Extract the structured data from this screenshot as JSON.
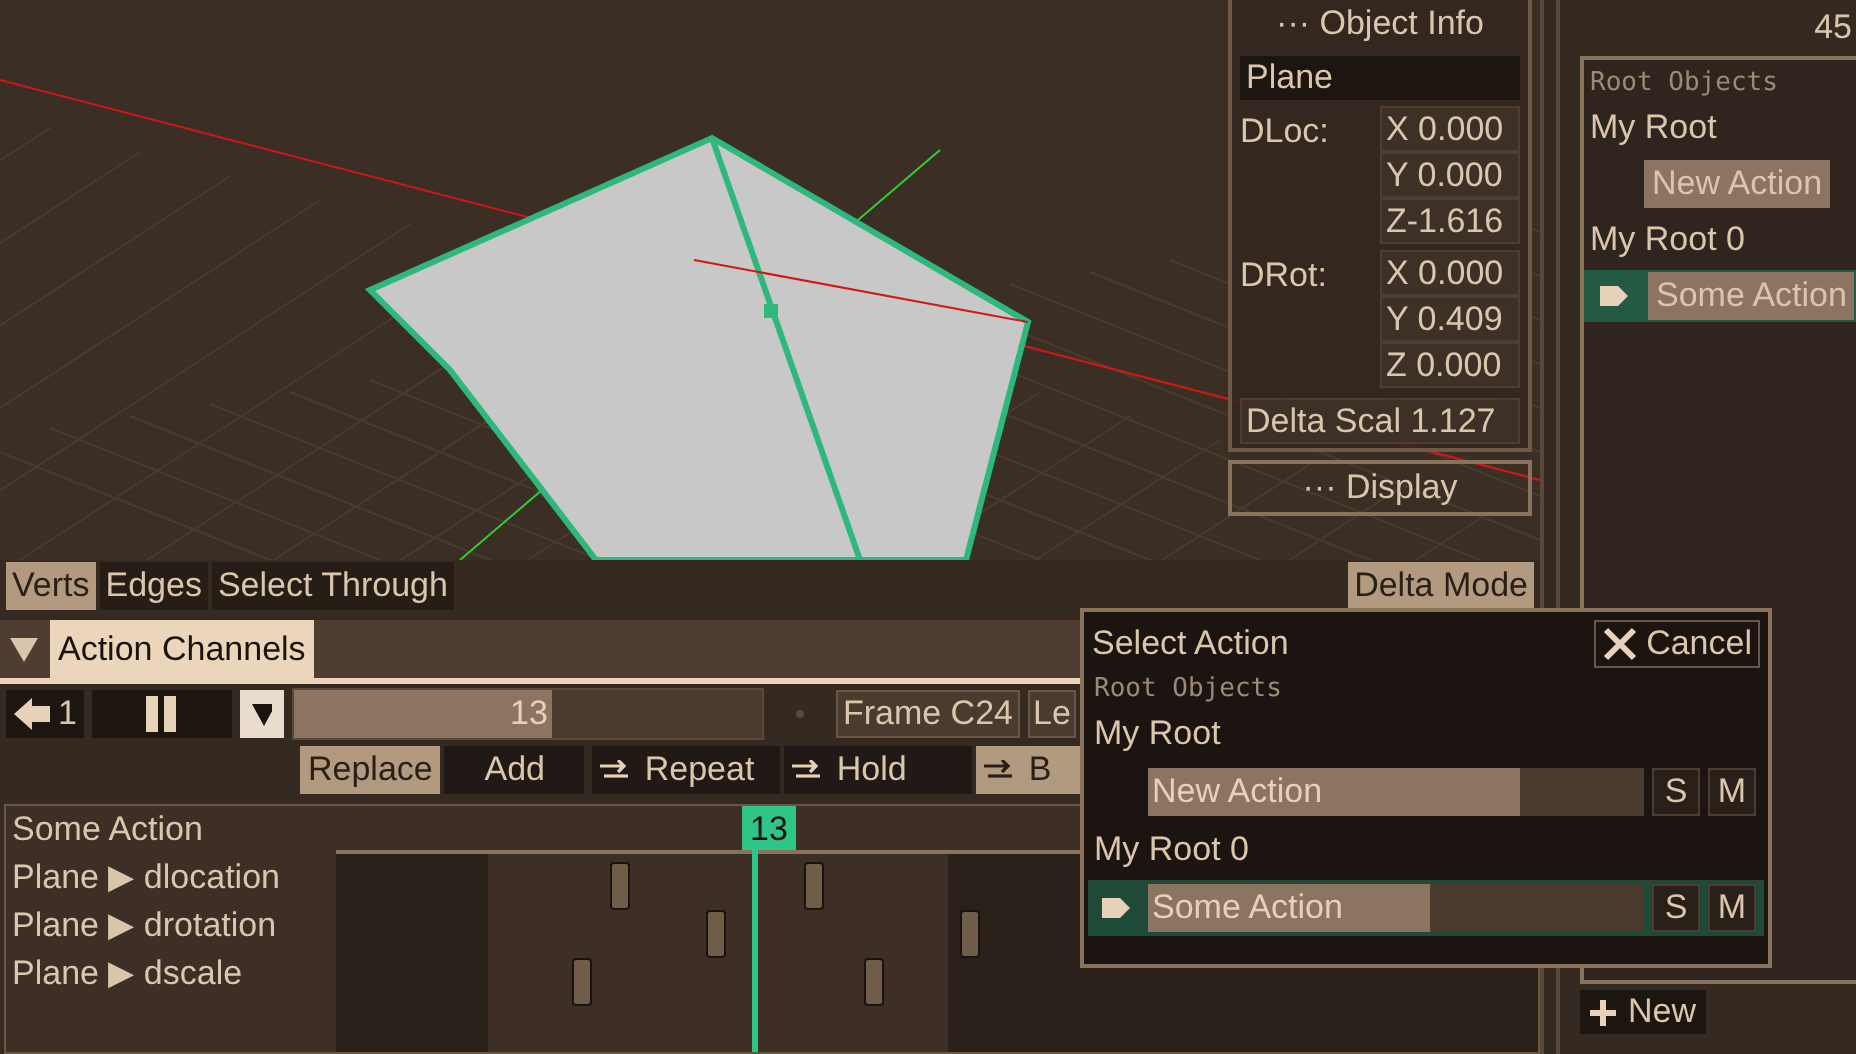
{
  "viewport": {
    "object_info": {
      "title": "··· Object Info",
      "name": "Plane",
      "groups": [
        {
          "label": "DLoc:",
          "fields": [
            "X 0.000",
            "Y 0.000",
            "Z-1.616"
          ]
        },
        {
          "label": "DRot:",
          "fields": [
            "X 0.000",
            "Y 0.409",
            "Z 0.000"
          ]
        }
      ],
      "delta_scale": "Delta Scal 1.127"
    },
    "display_button": "··· Display",
    "select_modes": [
      {
        "label": "Verts",
        "selected": true
      },
      {
        "label": "Edges",
        "selected": false
      },
      {
        "label": "Select Through",
        "selected": false
      }
    ],
    "delta_mode": "Delta Mode"
  },
  "action_channels": {
    "title": "Action Channels",
    "expanded": true,
    "toolbar": {
      "prev": "1",
      "frame_slider": {
        "value": "13",
        "level": 0.55
      },
      "frame_field": "Frame C24",
      "len_field": "Le"
    },
    "blend_modes": [
      {
        "label": "Replace",
        "selected": true
      },
      {
        "label": "Add",
        "selected": false
      }
    ],
    "extend_modes": [
      {
        "label": "Repeat",
        "selected": false
      },
      {
        "label": "Hold",
        "selected": false
      },
      {
        "label": "B",
        "selected": true
      }
    ],
    "timeline": {
      "action": "Some Action",
      "playhead": "13",
      "channels": [
        "Plane ▶ dlocation",
        "Plane ▶ drotation",
        "Plane ▶ dscale"
      ]
    }
  },
  "popup": {
    "title": "Select Action",
    "cancel": "Cancel",
    "section": "Root Objects",
    "roots": [
      {
        "name": "My Root",
        "actions": [
          {
            "name": "New Action",
            "level": 0.75,
            "selected": false,
            "solo": "S",
            "mute": "M"
          }
        ]
      },
      {
        "name": "My Root 0",
        "actions": [
          {
            "name": "Some Action",
            "level": 0.57,
            "selected": true,
            "solo": "S",
            "mute": "M"
          }
        ]
      }
    ]
  },
  "side_panel": {
    "header": "45",
    "section": "Root Objects",
    "roots": [
      {
        "name": "My Root",
        "actions": [
          {
            "name": "New Action",
            "selected": false
          }
        ]
      },
      {
        "name": "My Root 0",
        "actions": [
          {
            "name": "Some Action",
            "selected": true
          }
        ]
      }
    ],
    "new_button": "New"
  }
}
